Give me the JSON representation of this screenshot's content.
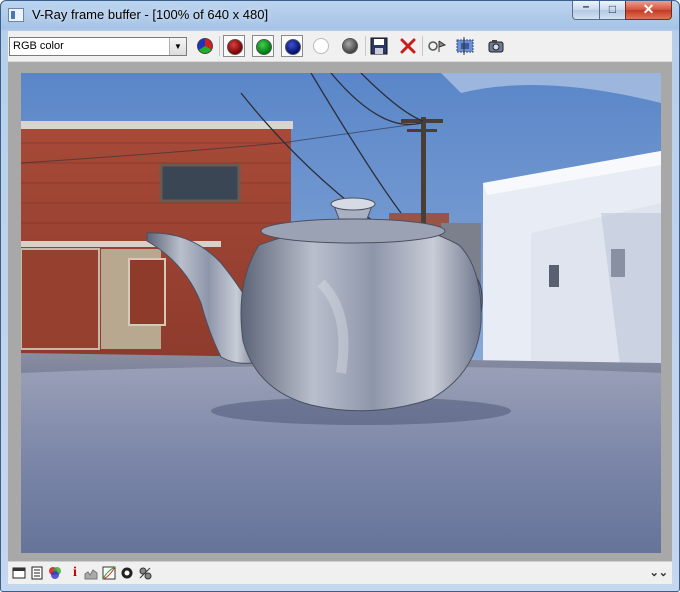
{
  "window": {
    "title": "V-Ray frame buffer - [100% of 640 x 480]",
    "controls": {
      "minimize": "–",
      "maximize": "□",
      "close": "✕"
    }
  },
  "toolbar": {
    "channel_select": {
      "value": "RGB color"
    },
    "buttons": [
      {
        "name": "color-channels-icon",
        "pressed": false
      },
      {
        "name": "red-channel-icon",
        "pressed": true,
        "color": "#7a0000"
      },
      {
        "name": "green-channel-icon",
        "pressed": true,
        "color": "#007a10"
      },
      {
        "name": "blue-channel-icon",
        "pressed": true,
        "color": "#00106e"
      },
      {
        "name": "alpha-channel-icon",
        "pressed": false,
        "color": "#ffffff"
      },
      {
        "name": "monochrome-icon",
        "pressed": false,
        "color": "#555555"
      },
      {
        "name": "save-image-icon",
        "pressed": false
      },
      {
        "name": "clear-image-icon",
        "pressed": false,
        "color": "#cc1b1b"
      },
      {
        "name": "track-mouse-icon",
        "pressed": false
      },
      {
        "name": "region-render-icon",
        "pressed": false
      },
      {
        "name": "render-last-icon",
        "pressed": false
      }
    ]
  },
  "statusbar": {
    "icons": [
      "frame-buffer-icon",
      "history-icon",
      "color-correction-icon",
      "info-icon",
      "levels-icon",
      "curves-icon",
      "lens-effects-icon",
      "settings-icon"
    ],
    "info_glyph": "i",
    "expand_glyph": "⌄⌄"
  },
  "render": {
    "resolution": "640 x 480",
    "zoom": "100%"
  }
}
